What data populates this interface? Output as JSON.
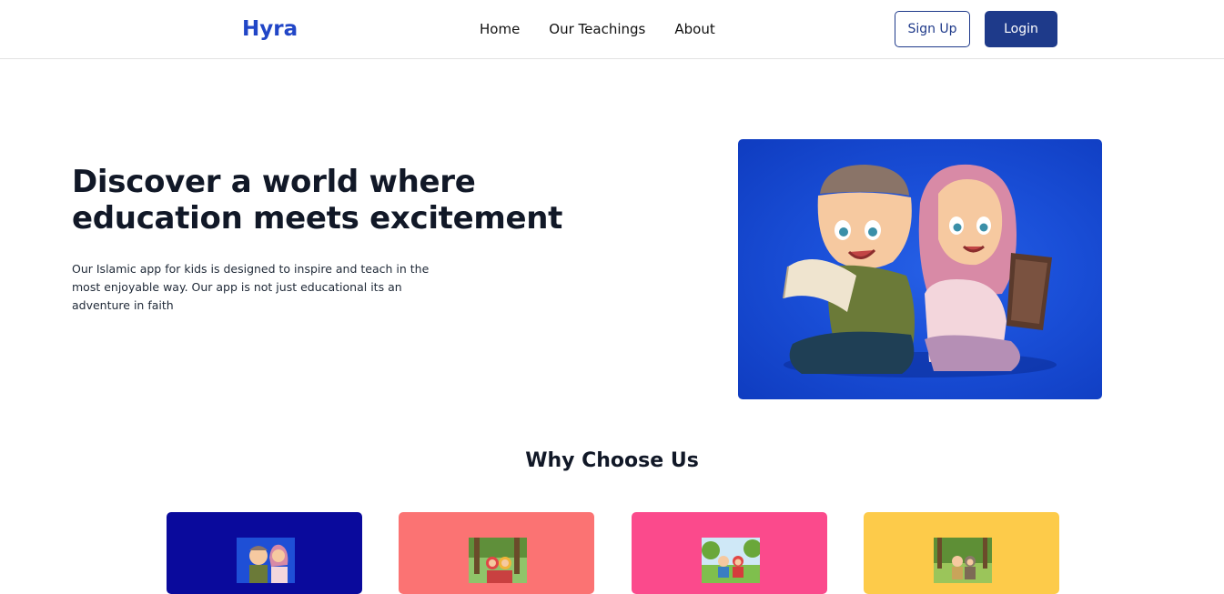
{
  "navbar": {
    "brand": "Hyra",
    "links": [
      "Home",
      "Our Teachings",
      "About"
    ],
    "signup_label": "Sign Up",
    "login_label": "Login"
  },
  "hero": {
    "title": "Discover a world where education meets excitement",
    "description": "Our Islamic app for kids is designed to inspire and teach in the most enjoyable way. Our app is not just educational its an adventure in faith",
    "image": "kids-reading-illustration"
  },
  "why_choose_us": {
    "title": "Why Choose Us",
    "cards": [
      {
        "color": "#0a0a9c",
        "image": "kids-reading-thumbnail"
      },
      {
        "color": "#fb7373",
        "image": "kids-forest-thumbnail"
      },
      {
        "color": "#fb4a8c",
        "image": "kids-park-thumbnail"
      },
      {
        "color": "#fdcb4a",
        "image": "kids-garden-thumbnail"
      }
    ]
  },
  "colors": {
    "brand": "#2146c7",
    "primary_button": "#1e3a8a"
  }
}
